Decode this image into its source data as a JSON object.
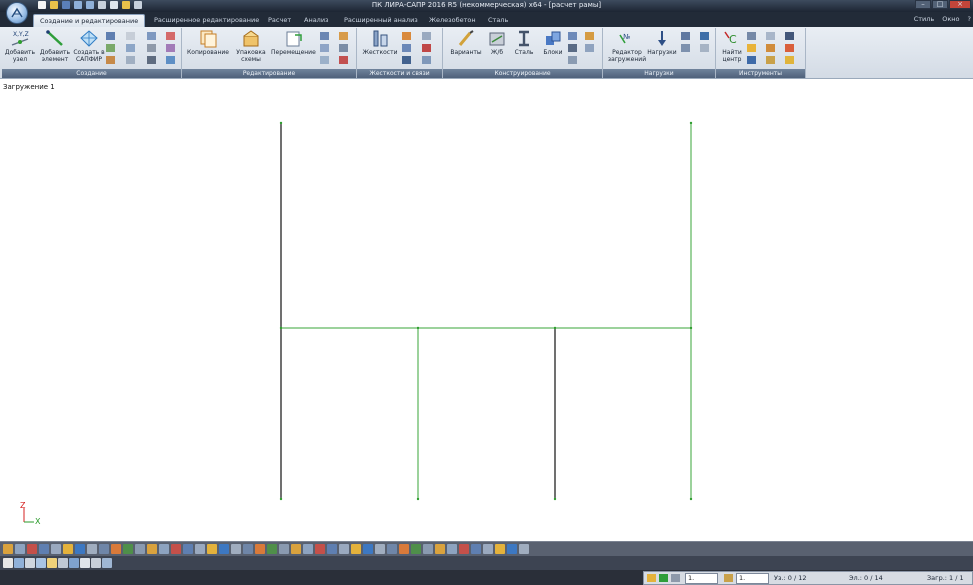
{
  "window": {
    "title": "ПК ЛИРА-САПР  2016 R5 (некоммерческая) x64 - [расчет рамы]",
    "menu_right": [
      "Стиль",
      "Окно",
      "?"
    ]
  },
  "tabs": [
    {
      "label": "Создание и редактирование",
      "active": true
    },
    {
      "label": "Расширенное редактирование",
      "active": false
    },
    {
      "label": "Расчет",
      "active": false
    },
    {
      "label": "Анализ",
      "active": false
    },
    {
      "label": "Расширенный анализ",
      "active": false
    },
    {
      "label": "Железобетон",
      "active": false
    },
    {
      "label": "Сталь",
      "active": false
    }
  ],
  "ribbon": {
    "groups": [
      {
        "caption": "Создание",
        "buttons": [
          "Добавить узел",
          "Добавить элемент",
          "Создать в САПФИР"
        ]
      },
      {
        "caption": "Редактирование",
        "buttons": [
          "Копирование",
          "Упаковка схемы",
          "Перемещение"
        ]
      },
      {
        "caption": "Жесткости и связи",
        "buttons": [
          "Жесткости"
        ]
      },
      {
        "caption": "Конструирование",
        "buttons": [
          "Варианты",
          "Ж/б",
          "Сталь",
          "Блоки"
        ]
      },
      {
        "caption": "Нагрузки",
        "buttons": [
          "Редактор загружений",
          "Нагрузки"
        ]
      },
      {
        "caption": "Инструменты",
        "buttons": [
          "Найти центр"
        ]
      }
    ]
  },
  "canvas": {
    "load_case_label": "Загружение 1",
    "axis_z": "Z",
    "axis_x": "X"
  },
  "status": {
    "field_a_value": "1.",
    "field_b_value": "1.",
    "nodes": "Уз.: 0 / 12",
    "elements": "Эл.: 0 / 14",
    "loads": "Загр.: 1 / 1"
  },
  "colors": {
    "frame_line": "#111111",
    "frame_beam_green": "#3aa53a",
    "node_green": "#2e9e2e",
    "axis_z": "#d42020",
    "axis_x": "#2a9a2a"
  }
}
